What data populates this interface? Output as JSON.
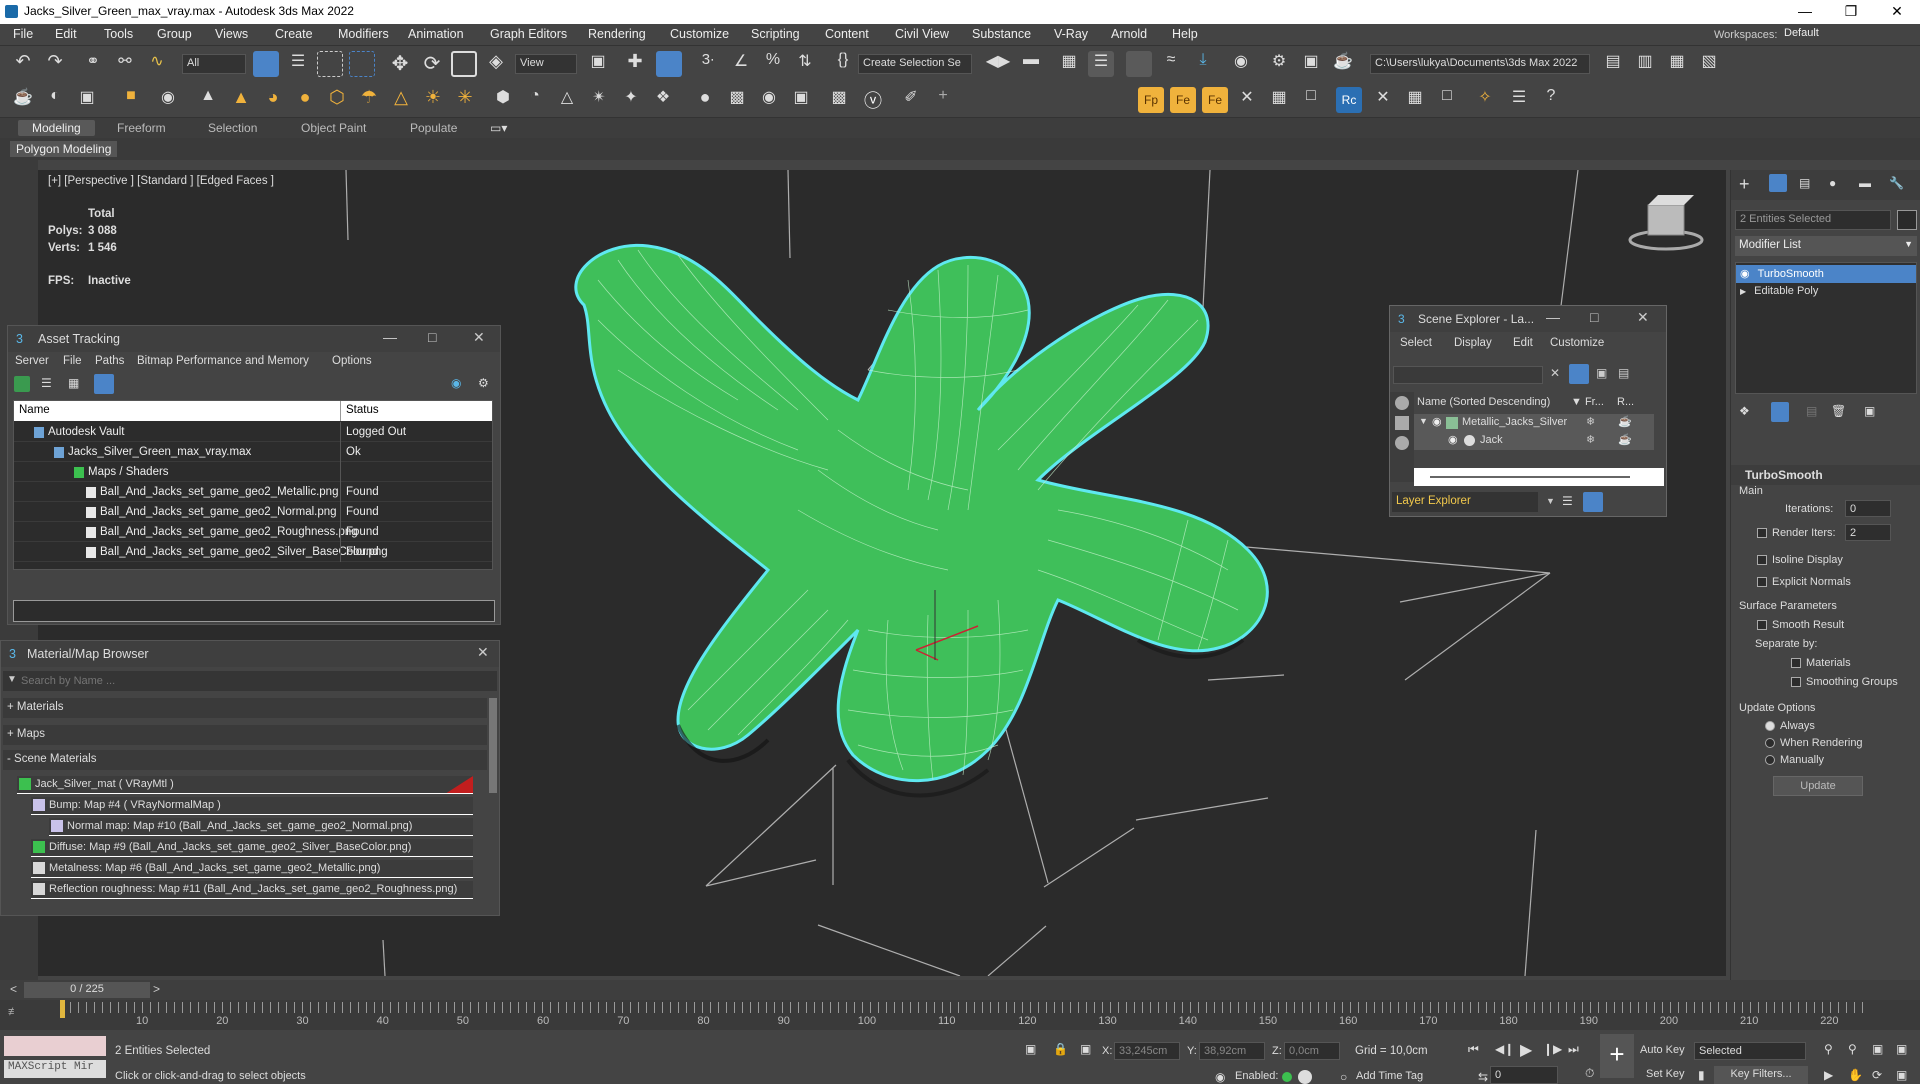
{
  "window": {
    "title": "Jacks_Silver_Green_max_vray.max - Autodesk 3ds Max 2022",
    "workspace_label": "Workspaces:",
    "workspace_value": "Default"
  },
  "menu": [
    "File",
    "Edit",
    "Tools",
    "Group",
    "Views",
    "Create",
    "Modifiers",
    "Animation",
    "Graph Editors",
    "Rendering",
    "Customize",
    "Scripting",
    "Content",
    "Civil View",
    "Substance",
    "V-Ray",
    "Arnold",
    "Help"
  ],
  "toolbar": {
    "filter_value": "All",
    "view_value": "View",
    "selection_set": "Create Selection Se",
    "project_path": "C:\\Users\\lukya\\Documents\\3ds Max 2022"
  },
  "ribbon": {
    "tabs": [
      "Modeling",
      "Freeform",
      "Selection",
      "Object Paint",
      "Populate"
    ],
    "sub": "Polygon Modeling"
  },
  "viewport": {
    "label": "[+] [Perspective ] [Standard ] [Edged Faces ]",
    "stats_total": "Total",
    "polys_label": "Polys:",
    "polys": "3 088",
    "verts_label": "Verts:",
    "verts": "1 546",
    "fps_label": "FPS:",
    "fps": "Inactive",
    "object_color": "#3fbf5a",
    "selection_color": "#5fe8f0"
  },
  "asset_tracking": {
    "title": "Asset Tracking",
    "menu": [
      "Server",
      "File",
      "Paths",
      "Bitmap Performance and Memory",
      "Options"
    ],
    "col_name": "Name",
    "col_status": "Status",
    "rows": [
      {
        "name": "Autodesk Vault",
        "status": "Logged Out"
      },
      {
        "name": "Jacks_Silver_Green_max_vray.max",
        "status": "Ok"
      },
      {
        "name": "Maps / Shaders",
        "status": ""
      },
      {
        "name": "Ball_And_Jacks_set_game_geo2_Metallic.png",
        "status": "Found"
      },
      {
        "name": "Ball_And_Jacks_set_game_geo2_Normal.png",
        "status": "Found"
      },
      {
        "name": "Ball_And_Jacks_set_game_geo2_Roughness.png",
        "status": "Found"
      },
      {
        "name": "Ball_And_Jacks_set_game_geo2_Silver_BaseColor.png",
        "status": "Found"
      }
    ]
  },
  "material_browser": {
    "title": "Material/Map Browser",
    "search_placeholder": "Search by Name ...",
    "groups": [
      "+ Materials",
      "+ Maps",
      "- Scene Materials"
    ],
    "items": [
      "Jack_Silver_mat  ( VRayMtl )",
      "Bump: Map #4  ( VRayNormalMap )",
      "Normal map: Map #10 (Ball_And_Jacks_set_game_geo2_Normal.png)",
      "Diffuse: Map #9 (Ball_And_Jacks_set_game_geo2_Silver_BaseColor.png)",
      "Metalness: Map #6 (Ball_And_Jacks_set_game_geo2_Metallic.png)",
      "Reflection roughness: Map #11 (Ball_And_Jacks_set_game_geo2_Roughness.png)"
    ]
  },
  "scene_explorer": {
    "title": "Scene Explorer - La...",
    "menu": [
      "Select",
      "Display",
      "Edit",
      "Customize"
    ],
    "col_name": "Name (Sorted Descending)",
    "col_fr": "▼ Fr...",
    "col_r": "R...",
    "items": [
      "Metallic_Jacks_Silver",
      "Jack"
    ],
    "footer": "Layer Explorer"
  },
  "command_panel": {
    "selected": "2 Entities Selected",
    "modifier_list": "Modifier List",
    "stack": [
      "TurboSmooth",
      "Editable Poly"
    ],
    "rollout": "TurboSmooth",
    "main": "Main",
    "iterations_label": "Iterations:",
    "iterations": "0",
    "render_iters_label": "Render Iters:",
    "render_iters": "2",
    "isoline": "Isoline Display",
    "explicit": "Explicit Normals",
    "surface_params": "Surface Parameters",
    "smooth_result": "Smooth Result",
    "separate_by": "Separate by:",
    "materials": "Materials",
    "smoothing_groups": "Smoothing Groups",
    "update_options": "Update Options",
    "always": "Always",
    "when_rendering": "When Rendering",
    "manually": "Manually",
    "update_btn": "Update"
  },
  "timeline": {
    "frame": "0 / 225",
    "ticks": [
      "10",
      "20",
      "30",
      "40",
      "50",
      "60",
      "70",
      "80",
      "90",
      "100",
      "110",
      "120",
      "130",
      "140",
      "150",
      "160",
      "170",
      "180",
      "190",
      "200",
      "210",
      "220"
    ]
  },
  "status": {
    "maxscript": "MAXScript Mir",
    "selected": "2 Entities Selected",
    "prompt": "Click or click-and-drag to select objects",
    "x_label": "X:",
    "x": "33,245cm",
    "y_label": "Y:",
    "y": "38,92cm",
    "z_label": "Z:",
    "z": "0,0cm",
    "grid": "Grid = 10,0cm",
    "enabled": "Enabled:",
    "add_time_tag": "Add Time Tag",
    "auto_key": "Auto Key",
    "set_key": "Set Key",
    "selected_dd": "Selected",
    "key_filters": "Key Filters...",
    "frame_field": "0"
  }
}
